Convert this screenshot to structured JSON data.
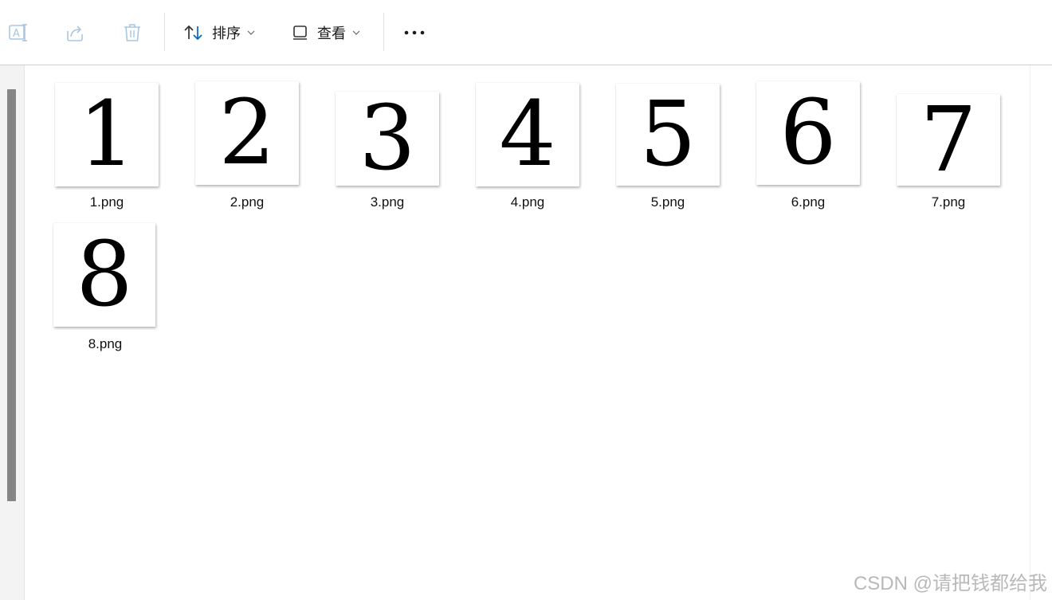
{
  "toolbar": {
    "rename_icon": "rename-icon",
    "share_icon": "share-icon",
    "delete_icon": "trash-icon",
    "sort_label": "排序",
    "view_label": "查看",
    "more_icon": "more-icon"
  },
  "files": [
    {
      "digit": "1",
      "name": "1.png"
    },
    {
      "digit": "2",
      "name": "2.png"
    },
    {
      "digit": "3",
      "name": "3.png"
    },
    {
      "digit": "4",
      "name": "4.png"
    },
    {
      "digit": "5",
      "name": "5.png"
    },
    {
      "digit": "6",
      "name": "6.png"
    },
    {
      "digit": "7",
      "name": "7.png"
    },
    {
      "digit": "8",
      "name": "8.png"
    }
  ],
  "watermark": "CSDN @请把钱都给我",
  "colors": {
    "accent": "#0067c0",
    "disabled_icon": "#a9c6e3",
    "scrollbar": "#858585"
  }
}
